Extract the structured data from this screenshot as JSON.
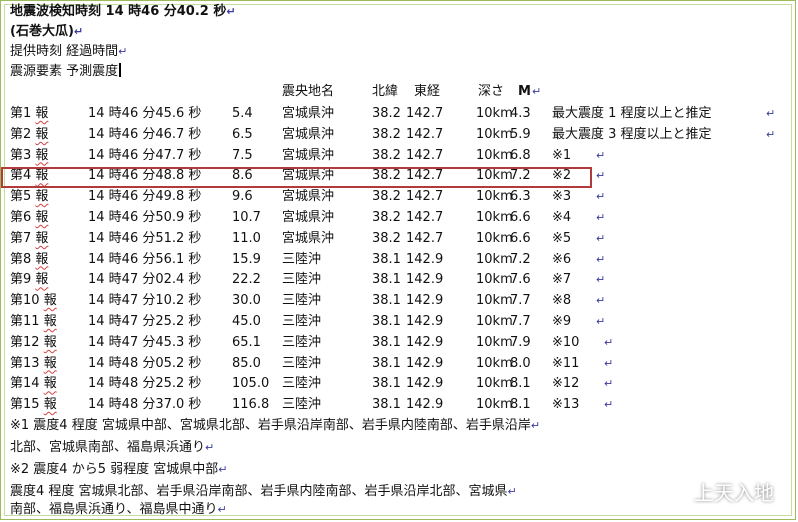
{
  "document": {
    "title": "地震波検知時刻 14 時46 分40.2 秒",
    "location": "(石巻大瓜)",
    "header_fields_1": "提供時刻 経過時間",
    "header_fields_2": "震源要素 予測震度",
    "table_header": {
      "region": "震央地名",
      "lat": "北緯",
      "lon": "東経",
      "depth": "深さ",
      "mag": "M"
    },
    "reports": [
      {
        "no": "第1 報",
        "time": "14 時46 分45.6 秒",
        "elapsed": "5.4",
        "region": "宮城県沖",
        "lat": "38.2",
        "lon": "142.7",
        "depth": "10km",
        "mag": "4.3",
        "note": "最大震度 1 程度以上と推定"
      },
      {
        "no": "第2 報",
        "time": "14 時46 分46.7 秒",
        "elapsed": "6.5",
        "region": "宮城県沖",
        "lat": "38.2",
        "lon": "142.7",
        "depth": "10km",
        "mag": "5.9",
        "note": "最大震度 3 程度以上と推定"
      },
      {
        "no": "第3 報",
        "time": "14 時46 分47.7 秒",
        "elapsed": "7.5",
        "region": "宮城県沖",
        "lat": "38.2",
        "lon": "142.7",
        "depth": "10km",
        "mag": "6.8",
        "note": "※1"
      },
      {
        "no": "第4 報",
        "time": "14 時46 分48.8 秒",
        "elapsed": "8.6",
        "region": "宮城県沖",
        "lat": "38.2",
        "lon": "142.7",
        "depth": "10km",
        "mag": "7.2",
        "note": "※2"
      },
      {
        "no": "第5 報",
        "time": "14 時46 分49.8 秒",
        "elapsed": "9.6",
        "region": "宮城県沖",
        "lat": "38.2",
        "lon": "142.7",
        "depth": "10km",
        "mag": "6.3",
        "note": "※3"
      },
      {
        "no": "第6 報",
        "time": "14 時46 分50.9 秒",
        "elapsed": "10.7",
        "region": "宮城県沖",
        "lat": "38.2",
        "lon": "142.7",
        "depth": "10km",
        "mag": "6.6",
        "note": "※4"
      },
      {
        "no": "第7 報",
        "time": "14 時46 分51.2 秒",
        "elapsed": "11.0",
        "region": "宮城県沖",
        "lat": "38.2",
        "lon": "142.7",
        "depth": "10km",
        "mag": "6.6",
        "note": "※5"
      },
      {
        "no": "第8 報",
        "time": "14 時46 分56.1 秒",
        "elapsed": "15.9",
        "region": "三陸沖",
        "lat": "38.1",
        "lon": "142.9",
        "depth": "10km",
        "mag": "7.2",
        "note": "※6"
      },
      {
        "no": "第9 報",
        "time": "14 時47 分02.4 秒",
        "elapsed": "22.2",
        "region": "三陸沖",
        "lat": "38.1",
        "lon": "142.9",
        "depth": "10km",
        "mag": "7.6",
        "note": "※7"
      },
      {
        "no": "第10 報",
        "time": "14 時47 分10.2 秒",
        "elapsed": "30.0",
        "region": "三陸沖",
        "lat": "38.1",
        "lon": "142.9",
        "depth": "10km",
        "mag": "7.7",
        "note": "※8"
      },
      {
        "no": "第11 報",
        "time": "14 時47 分25.2 秒",
        "elapsed": "45.0",
        "region": "三陸沖",
        "lat": "38.1",
        "lon": "142.9",
        "depth": "10km",
        "mag": "7.7",
        "note": "※9"
      },
      {
        "no": "第12 報",
        "time": "14 時47 分45.3 秒",
        "elapsed": "65.1",
        "region": "三陸沖",
        "lat": "38.1",
        "lon": "142.9",
        "depth": "10km",
        "mag": "7.9",
        "note": "※10"
      },
      {
        "no": "第13 報",
        "time": "14 時48 分05.2 秒",
        "elapsed": "85.0",
        "region": "三陸沖",
        "lat": "38.1",
        "lon": "142.9",
        "depth": "10km",
        "mag": "8.0",
        "note": "※11"
      },
      {
        "no": "第14 報",
        "time": "14 時48 分25.2 秒",
        "elapsed": "105.0",
        "region": "三陸沖",
        "lat": "38.1",
        "lon": "142.9",
        "depth": "10km",
        "mag": "8.1",
        "note": "※12"
      },
      {
        "no": "第15 報",
        "time": "14 時48 分37.0 秒",
        "elapsed": "116.8",
        "region": "三陸沖",
        "lat": "38.1",
        "lon": "142.9",
        "depth": "10km",
        "mag": "8.1",
        "note": "※13"
      }
    ],
    "footnotes": [
      "※1 震度4 程度 宮城県中部、宮城県北部、岩手県沿岸南部、岩手県内陸南部、岩手県沿岸",
      "北部、宮城県南部、福島県浜通り",
      "※2 震度4 から5 弱程度 宮城県中部",
      "震度4 程度 宮城県北部、岩手県沿岸南部、岩手県内陸南部、岩手県沿岸北部、宮城県",
      "南部、福島県浜通り、福島県中通り"
    ]
  },
  "watermark": {
    "icon": "wechat-icon",
    "text": "上天入地"
  },
  "colors": {
    "highlight_border": "#b33a3a",
    "frame": "#9bbb59"
  }
}
